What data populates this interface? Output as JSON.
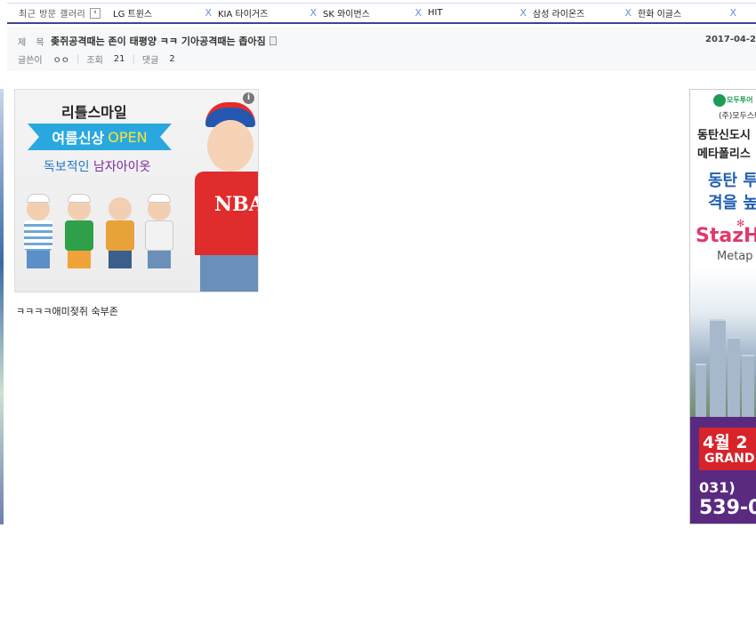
{
  "recent_gallery": {
    "label": "최근 방문 갤러리",
    "prev_symbol": "‹",
    "close_symbol": "X",
    "tabs": [
      {
        "name": "LG 트윈스"
      },
      {
        "name": "KIA 타이거즈"
      },
      {
        "name": "SK 와이번스"
      },
      {
        "name": "HIT"
      },
      {
        "name": "삼성 라이온즈"
      },
      {
        "name": "한화 이글스"
      }
    ]
  },
  "post": {
    "subject_label": "제 목",
    "title": "좆쥐공격때는 존이 태평양 ㅋㅋ 기아공격때는 좁아짐",
    "date": "2017-04-2",
    "author_label": "글쓴이",
    "author": "ㅇㅇ",
    "views_label": "조회",
    "views": "21",
    "comments_label": "댓글",
    "comments": "2",
    "body": "ㅋㅋㅋㅋ애미젖쥐 숙부존"
  },
  "ad_kids": {
    "info": "i",
    "brand": "리틀스마일",
    "banner_text": "여름신상",
    "banner_open": "OPEN",
    "tagline_a": "독보적인 ",
    "tagline_b": "남자아이옷",
    "shirt_text": "NBA"
  },
  "ad_right": {
    "logo_text": "모두투어",
    "company": "(주)모두스테",
    "line1": "동탄신도시",
    "line2": "메타폴리스",
    "big1": "동탄 투",
    "big2": "격을 높",
    "brand": "StazH",
    "sub": "Metap",
    "date": "4월 2",
    "grand": "GRAND",
    "phone1": "031)",
    "phone2": "539-0"
  },
  "colors": {
    "accent_bar": "#3b4890",
    "close_x": "#6f8ce0",
    "kids_banner": "#29a8e0",
    "right_brand": "#e0396b"
  }
}
